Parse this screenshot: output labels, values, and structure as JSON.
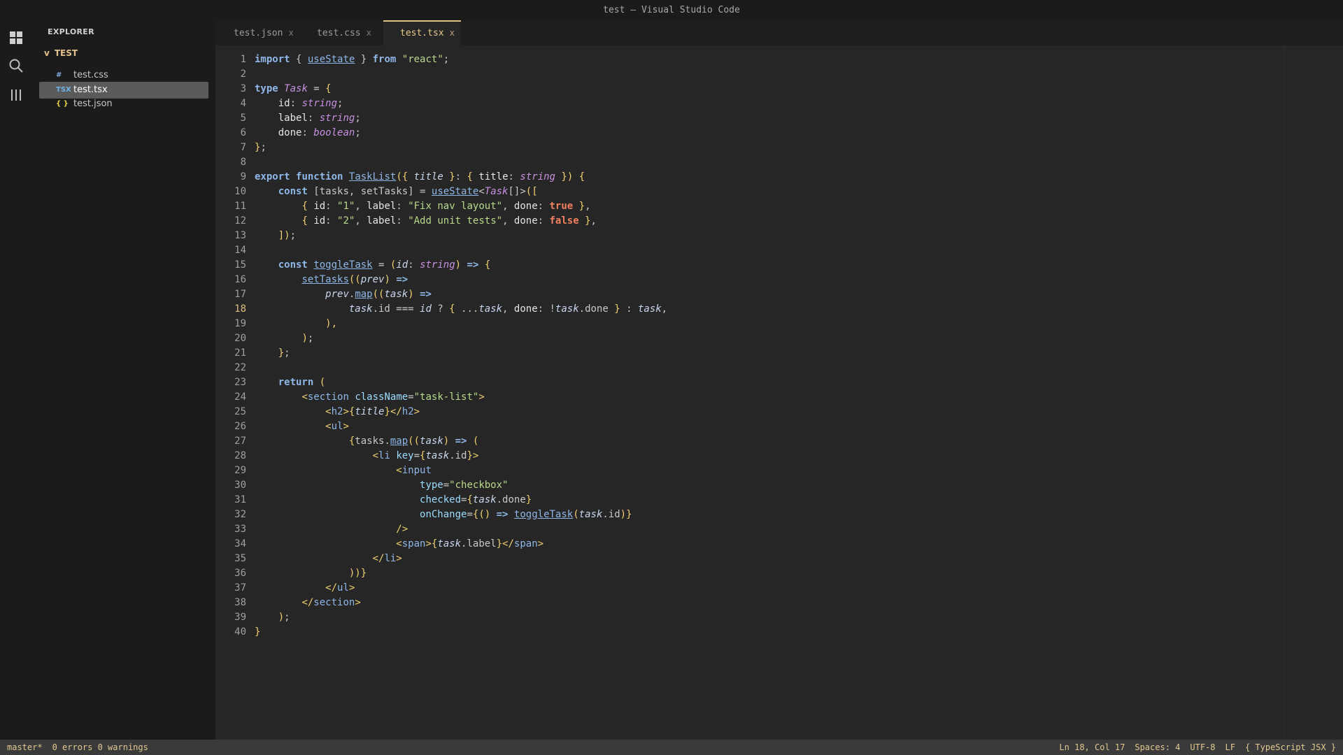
{
  "window": {
    "title": "test — Visual Studio Code"
  },
  "activity_bar": {
    "icons": [
      "explorer-icon",
      "search-icon",
      "extensions-icon"
    ]
  },
  "sidebar": {
    "title": "EXPLORER",
    "folder": {
      "chevron": "v",
      "name": "TEST"
    },
    "files": [
      {
        "name": "test.css",
        "icon": "#",
        "icon_color": "#7fb0e0",
        "active": false
      },
      {
        "name": "test.tsx",
        "icon": "TSX",
        "icon_color": "#6fb4e8",
        "active": true
      },
      {
        "name": "test.json",
        "icon": "{ }",
        "icon_color": "#e8d24a",
        "active": false
      }
    ]
  },
  "tabs": [
    {
      "label": "test.json",
      "close": "x",
      "active": false
    },
    {
      "label": "test.css",
      "close": "x",
      "active": false
    },
    {
      "label": "test.tsx",
      "close": "x",
      "active": true
    }
  ],
  "editor": {
    "current_line": 18,
    "lines": [
      [
        [
          "kw",
          "import"
        ],
        [
          "op",
          " { "
        ],
        [
          "fn",
          "useState"
        ],
        [
          "op",
          " } "
        ],
        [
          "kw",
          "from"
        ],
        [
          "op",
          " "
        ],
        [
          "str",
          "\"react\""
        ],
        [
          "op",
          ";"
        ]
      ],
      [],
      [
        [
          "kw",
          "type"
        ],
        [
          "op",
          " "
        ],
        [
          "ty",
          "Task"
        ],
        [
          "op",
          " = "
        ],
        [
          "pn",
          "{"
        ]
      ],
      [
        [
          "op",
          "    "
        ],
        [
          "prop",
          "id"
        ],
        [
          "op",
          ": "
        ],
        [
          "ty",
          "string"
        ],
        [
          "op",
          ";"
        ]
      ],
      [
        [
          "op",
          "    "
        ],
        [
          "prop",
          "label"
        ],
        [
          "op",
          ": "
        ],
        [
          "ty",
          "string"
        ],
        [
          "op",
          ";"
        ]
      ],
      [
        [
          "op",
          "    "
        ],
        [
          "prop",
          "done"
        ],
        [
          "op",
          ": "
        ],
        [
          "ty",
          "boolean"
        ],
        [
          "op",
          ";"
        ]
      ],
      [
        [
          "pn",
          "}"
        ],
        [
          "op",
          ";"
        ]
      ],
      [],
      [
        [
          "kw",
          "export"
        ],
        [
          "op",
          " "
        ],
        [
          "kw",
          "function"
        ],
        [
          "op",
          " "
        ],
        [
          "fn",
          "TaskList"
        ],
        [
          "pn",
          "({"
        ],
        [
          "op",
          " "
        ],
        [
          "param",
          "title"
        ],
        [
          "op",
          " "
        ],
        [
          "pn",
          "}"
        ],
        [
          "op",
          ": "
        ],
        [
          "pn",
          "{"
        ],
        [
          "op",
          " "
        ],
        [
          "prop",
          "title"
        ],
        [
          "op",
          ": "
        ],
        [
          "ty",
          "string"
        ],
        [
          "op",
          " "
        ],
        [
          "pn",
          "})"
        ],
        [
          "op",
          " "
        ],
        [
          "pn",
          "{"
        ]
      ],
      [
        [
          "op",
          "    "
        ],
        [
          "kw",
          "const"
        ],
        [
          "op",
          " [tasks, setTasks] = "
        ],
        [
          "fn",
          "useState"
        ],
        [
          "op",
          "<"
        ],
        [
          "ty",
          "Task"
        ],
        [
          "op",
          "[]>"
        ],
        [
          "pn",
          "(["
        ]
      ],
      [
        [
          "op",
          "        "
        ],
        [
          "pn",
          "{"
        ],
        [
          "op",
          " "
        ],
        [
          "prop",
          "id"
        ],
        [
          "op",
          ": "
        ],
        [
          "str",
          "\"1\""
        ],
        [
          "op",
          ", "
        ],
        [
          "prop",
          "label"
        ],
        [
          "op",
          ": "
        ],
        [
          "str",
          "\"Fix nav layout\""
        ],
        [
          "op",
          ", "
        ],
        [
          "prop",
          "done"
        ],
        [
          "op",
          ": "
        ],
        [
          "bool",
          "true"
        ],
        [
          "op",
          " "
        ],
        [
          "pn",
          "}"
        ],
        [
          "op",
          ","
        ]
      ],
      [
        [
          "op",
          "        "
        ],
        [
          "pn",
          "{"
        ],
        [
          "op",
          " "
        ],
        [
          "prop",
          "id"
        ],
        [
          "op",
          ": "
        ],
        [
          "str",
          "\"2\""
        ],
        [
          "op",
          ", "
        ],
        [
          "prop",
          "label"
        ],
        [
          "op",
          ": "
        ],
        [
          "str",
          "\"Add unit tests\""
        ],
        [
          "op",
          ", "
        ],
        [
          "prop",
          "done"
        ],
        [
          "op",
          ": "
        ],
        [
          "bool",
          "false"
        ],
        [
          "op",
          " "
        ],
        [
          "pn",
          "}"
        ],
        [
          "op",
          ","
        ]
      ],
      [
        [
          "op",
          "    "
        ],
        [
          "pn",
          "])"
        ],
        [
          "op",
          ";"
        ]
      ],
      [],
      [
        [
          "op",
          "    "
        ],
        [
          "kw",
          "const"
        ],
        [
          "op",
          " "
        ],
        [
          "fn",
          "toggleTask"
        ],
        [
          "op",
          " = "
        ],
        [
          "pn",
          "("
        ],
        [
          "param",
          "id"
        ],
        [
          "op",
          ": "
        ],
        [
          "ty",
          "string"
        ],
        [
          "pn",
          ")"
        ],
        [
          "op",
          " "
        ],
        [
          "kw",
          "=>"
        ],
        [
          "op",
          " "
        ],
        [
          "pn",
          "{"
        ]
      ],
      [
        [
          "op",
          "        "
        ],
        [
          "fn",
          "setTasks"
        ],
        [
          "pn",
          "(("
        ],
        [
          "param",
          "prev"
        ],
        [
          "pn",
          ")"
        ],
        [
          "op",
          " "
        ],
        [
          "kw",
          "=>"
        ]
      ],
      [
        [
          "op",
          "            "
        ],
        [
          "param",
          "prev"
        ],
        [
          "op",
          "."
        ],
        [
          "fn",
          "map"
        ],
        [
          "pn",
          "(("
        ],
        [
          "param",
          "task"
        ],
        [
          "pn",
          ")"
        ],
        [
          "op",
          " "
        ],
        [
          "kw",
          "=>"
        ]
      ],
      [
        [
          "op",
          "                "
        ],
        [
          "param",
          "task"
        ],
        [
          "op",
          ".id === "
        ],
        [
          "param",
          "id"
        ],
        [
          "op",
          " ? "
        ],
        [
          "pn",
          "{"
        ],
        [
          "op",
          " ..."
        ],
        [
          "param",
          "task"
        ],
        [
          "op",
          ", "
        ],
        [
          "prop",
          "done"
        ],
        [
          "op",
          ": !"
        ],
        [
          "param",
          "task"
        ],
        [
          "op",
          ".done "
        ],
        [
          "pn",
          "}"
        ],
        [
          "op",
          " : "
        ],
        [
          "param",
          "task"
        ],
        [
          "op",
          ","
        ]
      ],
      [
        [
          "op",
          "            "
        ],
        [
          "pn",
          "),"
        ]
      ],
      [
        [
          "op",
          "        "
        ],
        [
          "pn",
          ")"
        ],
        [
          "op",
          ";"
        ]
      ],
      [
        [
          "op",
          "    "
        ],
        [
          "pn",
          "}"
        ],
        [
          "op",
          ";"
        ]
      ],
      [],
      [
        [
          "op",
          "    "
        ],
        [
          "kw",
          "return"
        ],
        [
          "op",
          " "
        ],
        [
          "pn",
          "("
        ]
      ],
      [
        [
          "op",
          "        "
        ],
        [
          "pn",
          "<"
        ],
        [
          "tag",
          "section"
        ],
        [
          "op",
          " "
        ],
        [
          "attr",
          "className"
        ],
        [
          "op",
          "="
        ],
        [
          "str",
          "\"task-list\""
        ],
        [
          "pn",
          ">"
        ]
      ],
      [
        [
          "op",
          "            "
        ],
        [
          "pn",
          "<"
        ],
        [
          "tag",
          "h2"
        ],
        [
          "pn",
          ">{"
        ],
        [
          "param",
          "title"
        ],
        [
          "pn",
          "}</"
        ],
        [
          "tag",
          "h2"
        ],
        [
          "pn",
          ">"
        ]
      ],
      [
        [
          "op",
          "            "
        ],
        [
          "pn",
          "<"
        ],
        [
          "tag",
          "ul"
        ],
        [
          "pn",
          ">"
        ]
      ],
      [
        [
          "op",
          "                "
        ],
        [
          "pn",
          "{"
        ],
        [
          "op",
          "tasks."
        ],
        [
          "fn",
          "map"
        ],
        [
          "pn",
          "(("
        ],
        [
          "param",
          "task"
        ],
        [
          "pn",
          ")"
        ],
        [
          "op",
          " "
        ],
        [
          "kw",
          "=>"
        ],
        [
          "op",
          " "
        ],
        [
          "pn",
          "("
        ]
      ],
      [
        [
          "op",
          "                    "
        ],
        [
          "pn",
          "<"
        ],
        [
          "tag",
          "li"
        ],
        [
          "op",
          " "
        ],
        [
          "attr",
          "key"
        ],
        [
          "op",
          "="
        ],
        [
          "pn",
          "{"
        ],
        [
          "param",
          "task"
        ],
        [
          "op",
          ".id"
        ],
        [
          "pn",
          "}>"
        ]
      ],
      [
        [
          "op",
          "                        "
        ],
        [
          "pn",
          "<"
        ],
        [
          "tag",
          "input"
        ]
      ],
      [
        [
          "op",
          "                            "
        ],
        [
          "attr",
          "type"
        ],
        [
          "op",
          "="
        ],
        [
          "str",
          "\"checkbox\""
        ]
      ],
      [
        [
          "op",
          "                            "
        ],
        [
          "attr",
          "checked"
        ],
        [
          "op",
          "="
        ],
        [
          "pn",
          "{"
        ],
        [
          "param",
          "task"
        ],
        [
          "op",
          ".done"
        ],
        [
          "pn",
          "}"
        ]
      ],
      [
        [
          "op",
          "                            "
        ],
        [
          "attr",
          "onChange"
        ],
        [
          "op",
          "="
        ],
        [
          "pn",
          "{()"
        ],
        [
          "op",
          " "
        ],
        [
          "kw",
          "=>"
        ],
        [
          "op",
          " "
        ],
        [
          "fn",
          "toggleTask"
        ],
        [
          "pn",
          "("
        ],
        [
          "param",
          "task"
        ],
        [
          "op",
          ".id"
        ],
        [
          "pn",
          ")}"
        ]
      ],
      [
        [
          "op",
          "                        "
        ],
        [
          "pn",
          "/>"
        ]
      ],
      [
        [
          "op",
          "                        "
        ],
        [
          "pn",
          "<"
        ],
        [
          "tag",
          "span"
        ],
        [
          "pn",
          ">{"
        ],
        [
          "param",
          "task"
        ],
        [
          "op",
          ".label"
        ],
        [
          "pn",
          "}</"
        ],
        [
          "tag",
          "span"
        ],
        [
          "pn",
          ">"
        ]
      ],
      [
        [
          "op",
          "                    "
        ],
        [
          "pn",
          "</"
        ],
        [
          "tag",
          "li"
        ],
        [
          "pn",
          ">"
        ]
      ],
      [
        [
          "op",
          "                "
        ],
        [
          "pn",
          "))}"
        ]
      ],
      [
        [
          "op",
          "            "
        ],
        [
          "pn",
          "</"
        ],
        [
          "tag",
          "ul"
        ],
        [
          "pn",
          ">"
        ]
      ],
      [
        [
          "op",
          "        "
        ],
        [
          "pn",
          "</"
        ],
        [
          "tag",
          "section"
        ],
        [
          "pn",
          ">"
        ]
      ],
      [
        [
          "op",
          "    "
        ],
        [
          "pn",
          ")"
        ],
        [
          "op",
          ";"
        ]
      ],
      [
        [
          "pn",
          "}"
        ]
      ]
    ]
  },
  "statusbar": {
    "branch": "master*",
    "problems": "0 errors 0 warnings",
    "position": "Ln 18, Col 17",
    "indent": "Spaces: 4",
    "encoding": "UTF-8",
    "eol": "LF",
    "language": "{ TypeScript JSX }"
  }
}
